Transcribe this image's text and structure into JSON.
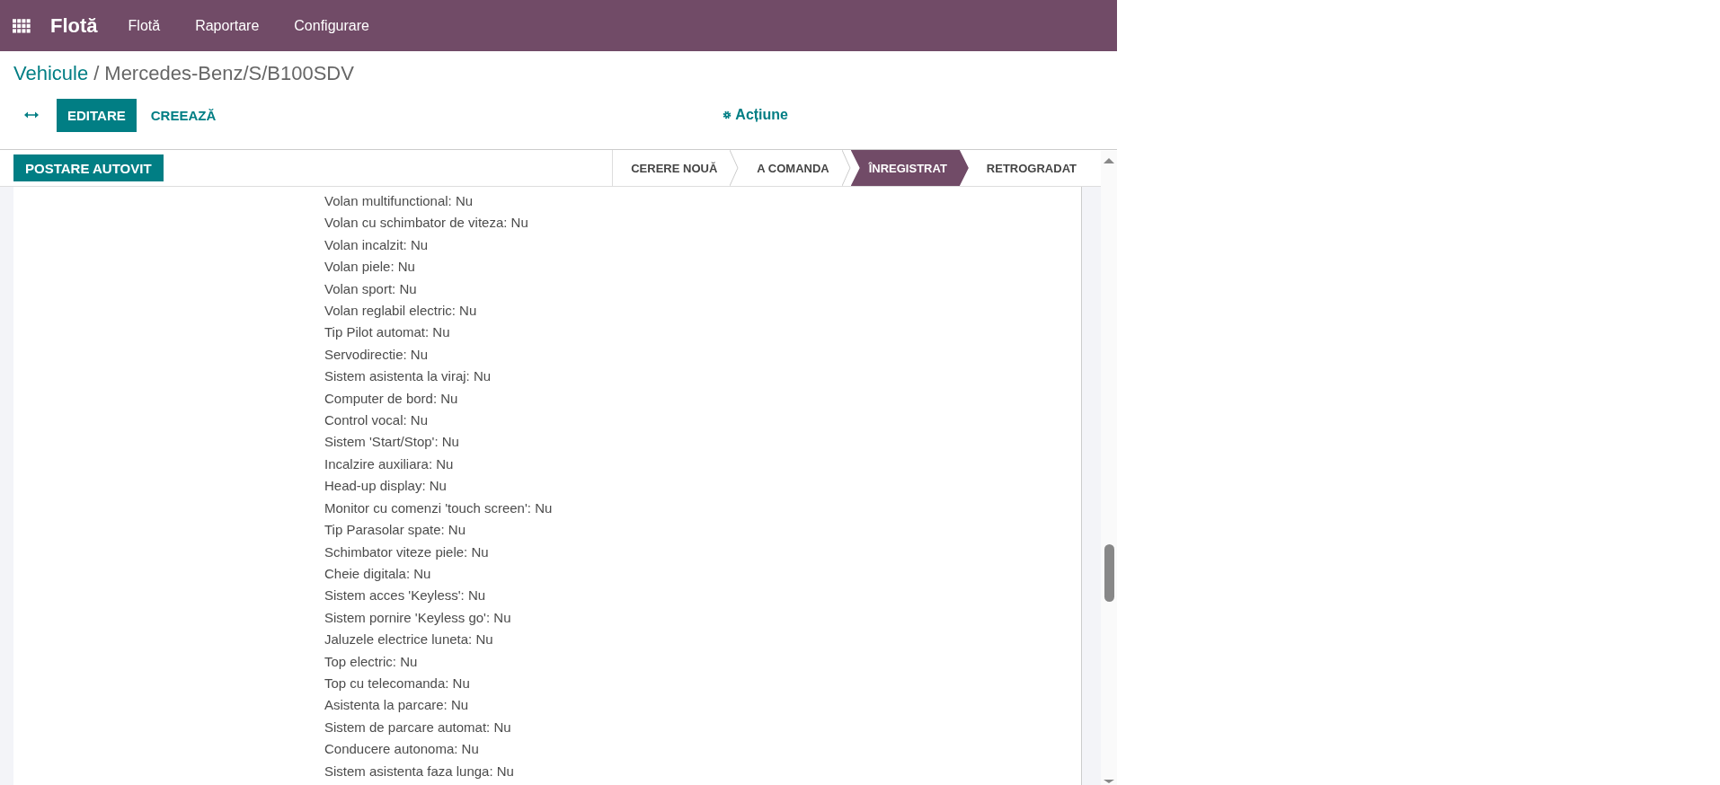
{
  "navbar": {
    "app_title": "Flotă",
    "menu": [
      {
        "label": "Flotă"
      },
      {
        "label": "Raportare"
      },
      {
        "label": "Configurare"
      }
    ]
  },
  "breadcrumb": {
    "parent": "Vehicule",
    "separator": "/",
    "current": "Mercedes-Benz/S/B100SDV"
  },
  "control_panel": {
    "buttons": [
      {
        "label": "EDITARE",
        "kind": "primary"
      },
      {
        "label": "CREEAZĂ",
        "kind": "link"
      }
    ],
    "action": "Acțiune"
  },
  "statusbar": {
    "buttons": [
      "POSTARE AUTOVIT"
    ],
    "stages": [
      {
        "label": "CERERE NOUĂ",
        "selected": false
      },
      {
        "label": "A COMANDA",
        "selected": false
      },
      {
        "label": "ÎNREGISTRAT",
        "selected": true
      },
      {
        "label": "RETROGRADAT",
        "selected": false
      }
    ]
  },
  "features": [
    "Volan multifunctional: Nu",
    "Volan cu schimbator de viteza: Nu",
    "Volan incalzit: Nu",
    "Volan piele: Nu",
    "Volan sport: Nu",
    "Volan reglabil electric: Nu",
    "Tip Pilot automat: Nu",
    "Servodirectie: Nu",
    "Sistem asistenta la viraj: Nu",
    "Computer de bord: Nu",
    "Control vocal: Nu",
    "Sistem 'Start/Stop': Nu",
    "Incalzire auxiliara: Nu",
    "Head-up display: Nu",
    "Monitor cu comenzi 'touch screen': Nu",
    "Tip Parasolar spate: Nu",
    "Schimbator viteze piele: Nu",
    "Cheie digitala: Nu",
    "Sistem acces 'Keyless': Nu",
    "Sistem pornire 'Keyless go': Nu",
    "Jaluzele electrice luneta: Nu",
    "Top electric: Nu",
    "Top cu telecomanda: Nu",
    "Asistenta la parcare: Nu",
    "Sistem de parcare automat: Nu",
    "Conducere autonoma: Nu",
    "Sistem asistenta faza lunga: Nu"
  ]
}
